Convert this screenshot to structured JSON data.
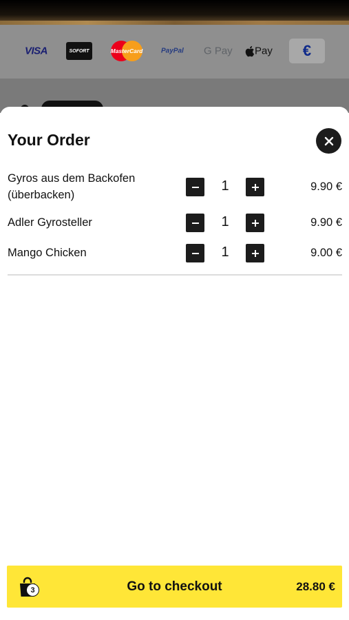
{
  "background": {
    "payment_methods": [
      "VISA",
      "SOFORT",
      "MasterCard",
      "PayPal",
      "G Pay",
      "Pay",
      "€"
    ]
  },
  "order": {
    "title": "Your Order",
    "items": [
      {
        "name": "Gyros aus dem Backofen (überbacken)",
        "quantity": "1",
        "price": "9.90 €"
      },
      {
        "name": "Adler Gyrosteller",
        "quantity": "1",
        "price": "9.90 €"
      },
      {
        "name": "Mango Chicken",
        "quantity": "1",
        "price": "9.00 €"
      }
    ]
  },
  "checkout": {
    "label": "Go to checkout",
    "total": "28.80 €",
    "item_count": "3"
  },
  "colors": {
    "accent": "#ffe637",
    "dark": "#1c1c1c"
  },
  "icons": {
    "close": "close-icon",
    "minus": "minus-icon",
    "plus": "plus-icon",
    "bag": "shopping-bag-icon"
  }
}
